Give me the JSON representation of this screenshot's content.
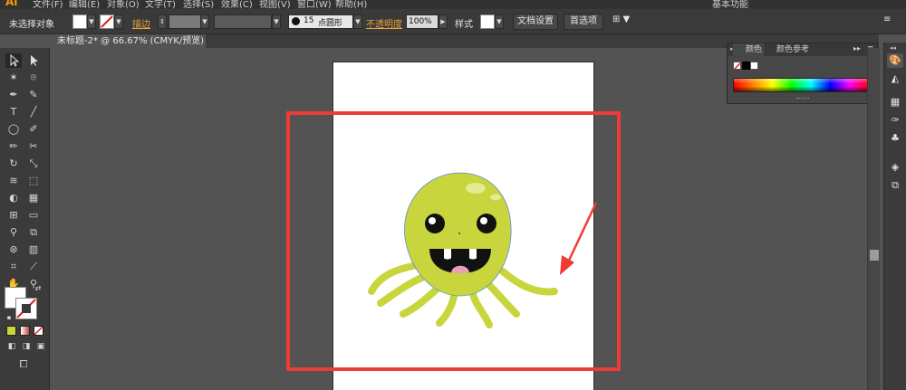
{
  "menubar": {
    "logo": "Ai",
    "items": [
      "文件(F)",
      "编辑(E)",
      "对象(O)",
      "文字(T)",
      "选择(S)",
      "效果(C)",
      "视图(V)",
      "窗口(W)",
      "帮助(H)"
    ],
    "workspace": "基本功能"
  },
  "control": {
    "no_selection": "未选择对象",
    "stroke_label": "描边",
    "brush_size": "15",
    "brush_shape": "点圆形",
    "opacity_label": "不透明度",
    "opacity_value": "100%",
    "style_label": "样式",
    "doc_setup": "文档设置",
    "preferences": "首选项"
  },
  "document_tab": {
    "title": "未标题-2* @ 66.67% (CMYK/预览)",
    "close": "✕"
  },
  "color_panel": {
    "tab_color": "颜色",
    "tab_color_guide": "颜色参考"
  },
  "colors": {
    "octopus_body": "#c8d53d",
    "octopus_highlight": "#e4eb8f",
    "mouth": "#111111",
    "tongue": "#e8a0b4",
    "annotation": "#ef3b36",
    "accent": "#ff9a00"
  },
  "icons": {
    "selection": "selection-tool-icon",
    "direct_selection": "direct-selection-tool-icon",
    "magic_wand": "magic-wand-icon",
    "lasso": "lasso-icon",
    "pen": "pen-tool-icon",
    "curvature": "curvature-tool-icon",
    "type": "type-tool-icon",
    "line": "line-tool-icon",
    "ellipse": "ellipse-tool-icon",
    "brush": "paintbrush-icon",
    "pencil": "pencil-icon",
    "scissors": "scissors-icon",
    "rotate": "rotate-icon",
    "scale": "scale-icon",
    "hand": "hand-tool-icon",
    "zoom": "zoom-tool-icon"
  }
}
